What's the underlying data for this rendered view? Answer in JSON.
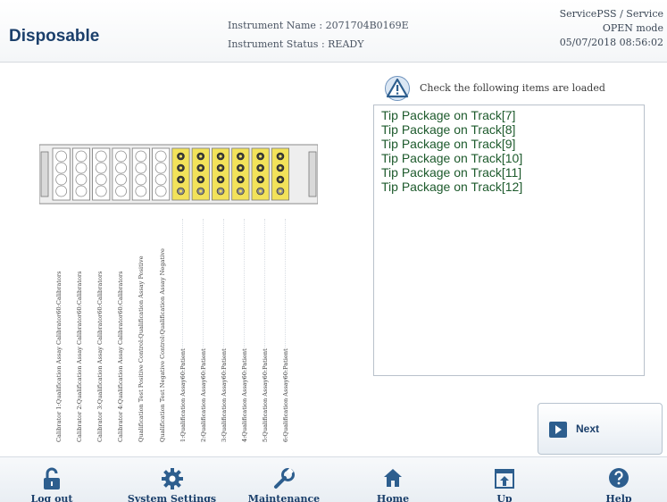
{
  "header": {
    "title": "Disposable",
    "instrument_name": "Instrument Name : 2071704B0169E",
    "instrument_status": "Instrument Status : READY",
    "user": "ServicePSS / Service",
    "mode": "OPEN mode",
    "datetime": "05/07/2018 08:56:02"
  },
  "notice": {
    "icon": "warning-triangle-icon",
    "text": "Check the following items are loaded",
    "items": [
      "Tip Package on Track[7]",
      "Tip Package on Track[8]",
      "Tip Package on Track[9]",
      "Tip Package on Track[10]",
      "Tip Package on Track[11]",
      "Tip Package on Track[12]"
    ]
  },
  "tracks": {
    "empty_color": "#ffffff",
    "loaded_color": "#f2e25a",
    "loaded_tracks": [
      7,
      8,
      9,
      10,
      11,
      12
    ],
    "labels": [
      "Calibrator 1:Qualification Assay Calibrator60:Calibrators",
      "Calibrator 2:Qualification Assay Calibrator60:Calibrators",
      "Calibrator 3:Qualification Assay Calibrator60:Calibrators",
      "Calibrator 4:Qualification Assay Calibrator60:Calibrators",
      "Qualification Test Positive Control:Qualification Assay Positive",
      "Qualification Test Negative Control:Qualification Assay Negative",
      "1:Qualification Assay60:Patient",
      "2:Qualification Assay60:Patient",
      "3:Qualification Assay60:Patient",
      "4:Qualification Assay60:Patient",
      "5:Qualification Assay60:Patient",
      "6:Qualification Assay60:Patient"
    ]
  },
  "next_button": {
    "label": "Next",
    "icon": "arrow-right-icon"
  },
  "bottom_nav": [
    {
      "label": "Log out",
      "icon": "unlock-icon"
    },
    {
      "label": "System Settings",
      "icon": "gear-icon"
    },
    {
      "label": "Maintenance",
      "icon": "wrench-icon"
    },
    {
      "label": "Home",
      "icon": "home-icon"
    },
    {
      "label": "Up",
      "icon": "up-arrow-icon"
    },
    {
      "label": "Help",
      "icon": "help-icon"
    }
  ],
  "colors": {
    "accent": "#2d5e8e",
    "title": "#1b3f6b",
    "item_text": "#1d5a2c"
  }
}
